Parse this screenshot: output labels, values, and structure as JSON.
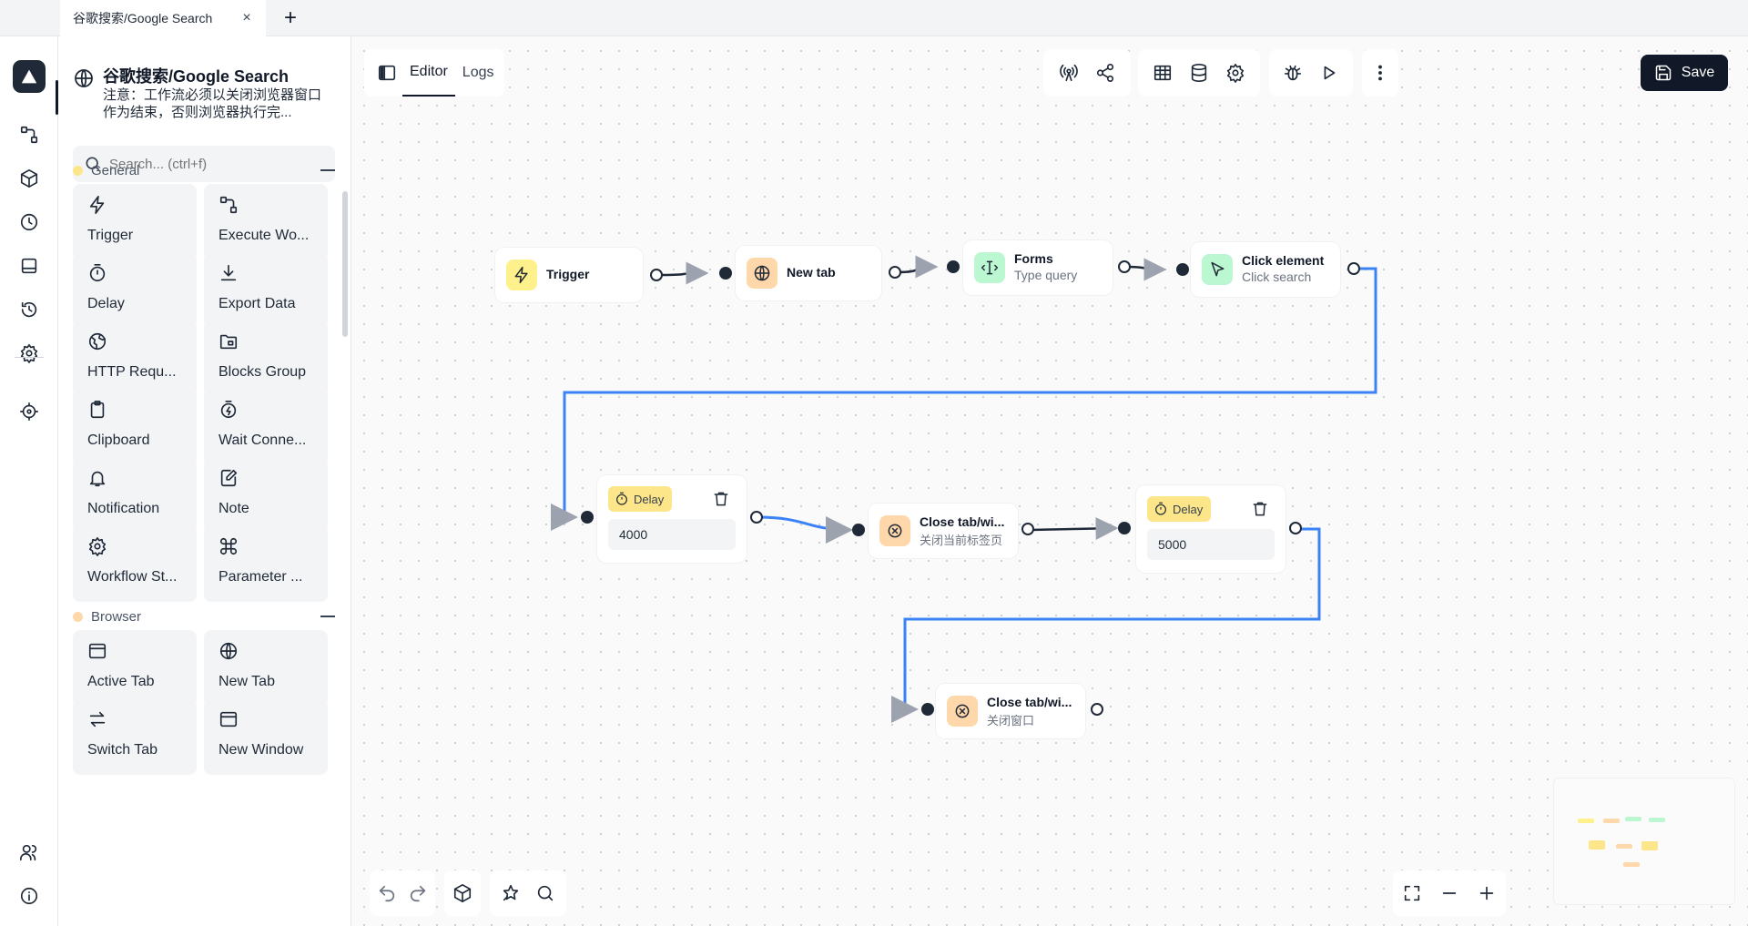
{
  "browser_tab": {
    "title": "谷歌搜索/Google Search",
    "close": "×",
    "add": "+"
  },
  "rail": {
    "items": [
      {
        "name": "workflows-icon"
      },
      {
        "name": "packages-icon"
      },
      {
        "name": "schedule-icon"
      },
      {
        "name": "storage-icon"
      },
      {
        "name": "logs-icon"
      },
      {
        "name": "settings-icon"
      },
      {
        "name": "recorder-icon"
      },
      {
        "name": "team-icon"
      },
      {
        "name": "about-icon"
      }
    ]
  },
  "workflow": {
    "title": "谷歌搜索/Google Search",
    "description": "注意：工作流必须以关闭浏览器窗口作为结束，否则浏览器执行完..."
  },
  "search": {
    "placeholder": "Search... (ctrl+f)"
  },
  "categories": [
    {
      "label": "General",
      "color": "#fde68a",
      "blocks": [
        "Trigger",
        "Execute Wo...",
        "Delay",
        "Export Data",
        "HTTP Requ...",
        "Blocks Group",
        "Clipboard",
        "Wait Conne...",
        "Notification",
        "Note",
        "Workflow St...",
        "Parameter ..."
      ]
    },
    {
      "label": "Browser",
      "color": "#fed7aa",
      "blocks": [
        "Active Tab",
        "New Tab",
        "Switch Tab",
        "New Window"
      ]
    }
  ],
  "editor": {
    "tabs": [
      "Editor",
      "Logs"
    ],
    "active_tab": "Editor",
    "save_label": "Save"
  },
  "nodes": {
    "trigger": {
      "title": "Trigger",
      "color": "#fef08a"
    },
    "new_tab": {
      "title": "New tab",
      "color": "#fed7aa"
    },
    "forms": {
      "title": "Forms",
      "subtitle": "Type query",
      "color": "#bbf7d0"
    },
    "click": {
      "title": "Click element",
      "subtitle": "Click search",
      "color": "#bbf7d0"
    },
    "delay1": {
      "label": "Delay",
      "value": "4000",
      "color": "#fde68a"
    },
    "close1": {
      "title": "Close tab/wi...",
      "subtitle": "关闭当前标签页",
      "color": "#fed7aa"
    },
    "delay2": {
      "label": "Delay",
      "value": "5000",
      "color": "#fde68a"
    },
    "close2": {
      "title": "Close tab/wi...",
      "subtitle": "关闭窗口",
      "color": "#fed7aa"
    }
  },
  "colors": {
    "edge": "#1f2937",
    "edge_selected": "#3b82f6",
    "save_bg": "#111827"
  }
}
